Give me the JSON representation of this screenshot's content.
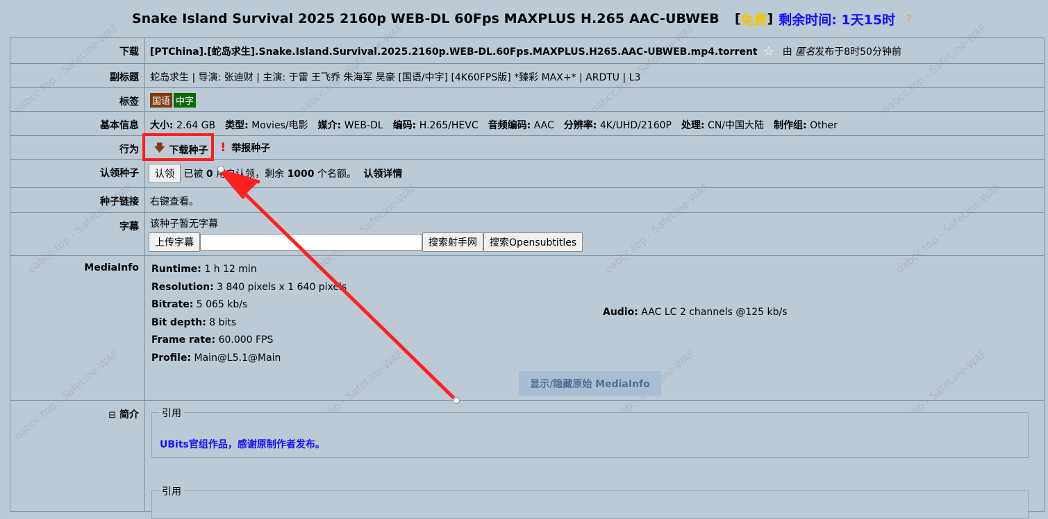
{
  "header": {
    "title": "Snake Island Survival 2025 2160p WEB-DL 60Fps MAXPLUS H.265 AAC-UBWEB",
    "bracket_open": "[",
    "free_label": "免费",
    "bracket_close": "]",
    "remaining_label": "剩余时间: 1天15时",
    "help_icon_text": "?"
  },
  "rows": {
    "download": {
      "label": "下载",
      "filename": "[PTChina].[蛇岛求生].Snake.Island.Survival.2025.2160p.WEB-DL.60Fps.MAXPLUS.H265.AAC-UBWEB.mp4.torrent",
      "star_icon": "star-outline-icon",
      "by_prefix": "由",
      "uploader": "匿名",
      "published": "发布于8时50分钟前"
    },
    "subtitle": {
      "label": "副标题",
      "text": "蛇岛求生 | 导演: 张迪财 | 主演: 于雷 王飞乔 朱海军 吴豪 [国语/中字] [4K60FPS版] *臻彩 MAX+* | ARDTU | L3"
    },
    "tags": {
      "label": "标签",
      "items": [
        "国语",
        "中字"
      ],
      "colors": [
        "#7a3b0e",
        "#0c6b0c"
      ]
    },
    "basic": {
      "label": "基本信息",
      "fields": [
        {
          "k": "大小:",
          "v": "2.64 GB"
        },
        {
          "k": "类型:",
          "v": "Movies/电影"
        },
        {
          "k": "媒介:",
          "v": "WEB-DL"
        },
        {
          "k": "编码:",
          "v": "H.265/HEVC"
        },
        {
          "k": "音频编码:",
          "v": "AAC"
        },
        {
          "k": "分辨率:",
          "v": "4K/UHD/2160P"
        },
        {
          "k": "处理:",
          "v": "CN/中国大陆"
        },
        {
          "k": "制作组:",
          "v": "Other"
        }
      ]
    },
    "action": {
      "label": "行为",
      "download_label": "下载种子",
      "download_icon": "down-arrow-icon",
      "report_label": "举报种子",
      "report_icon": "exclamation-icon",
      "highlight_color": "#ff1f1f"
    },
    "claim": {
      "label": "认领种子",
      "button": "认领",
      "text_before": "已被",
      "count": "0",
      "text_after": "用户认领，剩余",
      "remaining": "1000",
      "text_end": "个名额。",
      "details_link": "认领详情"
    },
    "link": {
      "label": "种子链接",
      "text": "右键查看。"
    },
    "subs": {
      "label": "字幕",
      "note": "该种子暂无字幕",
      "upload_button": "上传字幕",
      "search_value": "",
      "search_shooter_button": "搜索射手网",
      "search_opensub_button": "搜索Opensubtitles"
    },
    "mediainfo": {
      "label": "MediaInfo",
      "video": [
        {
          "k": "Runtime:",
          "v": "1 h 12 min"
        },
        {
          "k": "Resolution:",
          "v": "3 840 pixels x 1 640 pixels"
        },
        {
          "k": "Bitrate:",
          "v": "5 065 kb/s"
        },
        {
          "k": "Bit depth:",
          "v": "8 bits"
        },
        {
          "k": "Frame rate:",
          "v": "60.000 FPS"
        },
        {
          "k": "Profile:",
          "v": "Main@L5.1@Main"
        }
      ],
      "audio": {
        "k": "Audio:",
        "v": "AAC LC 2 channels @125 kb/s"
      },
      "toggle_button": "显示/隐藏原始 MediaInfo"
    },
    "intro": {
      "collapse_icon": "⊟",
      "label": "简介",
      "quote1_label": "引用",
      "quote1_text": "UBits官组作品，感谢原制作者发布。",
      "quote2_label": "引用"
    }
  },
  "watermark_text": "oabcc.top - SafeLine-WAF",
  "annotation_color": "#ff2020"
}
